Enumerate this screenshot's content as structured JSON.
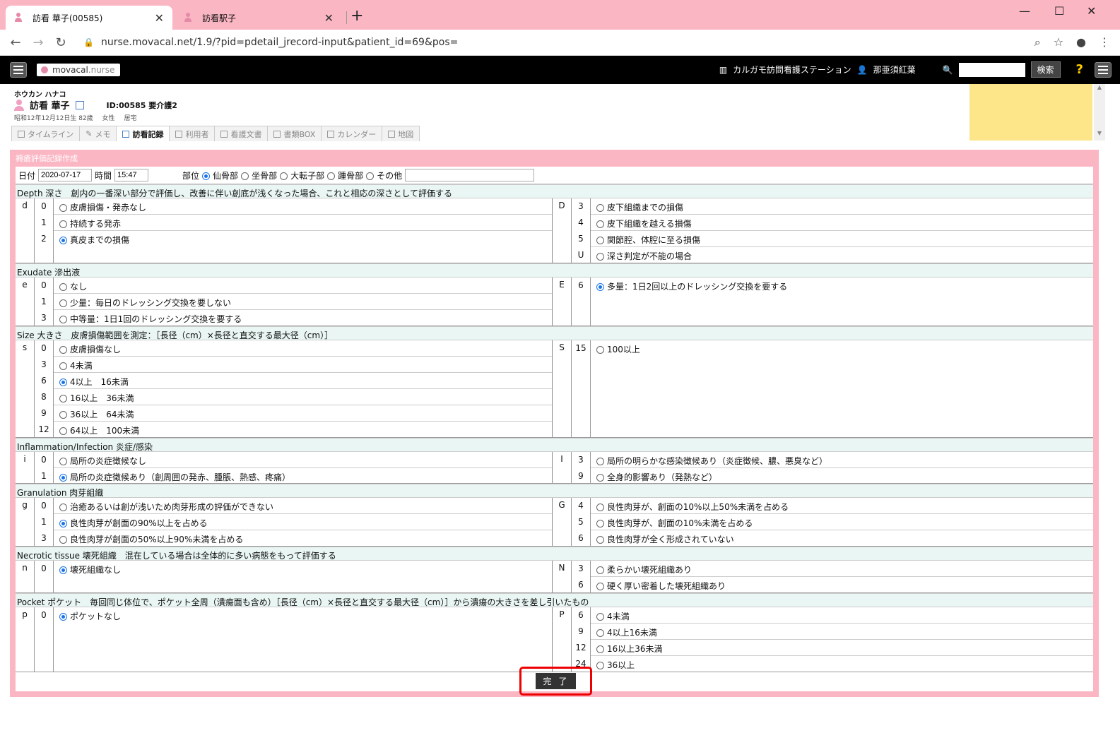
{
  "browser": {
    "tabs": [
      {
        "title": "訪看 華子(00585)"
      },
      {
        "title": "訪看駅子"
      }
    ],
    "new_tab": "+",
    "url": "nurse.movacal.net/1.9/?pid=pdetail_jrecord-input&patient_id=69&pos="
  },
  "app": {
    "logo_main": "movacal",
    "logo_sub": ".nurse",
    "station": "カルガモ訪問看護ステーション",
    "user": "那亜須紅葉",
    "search_button": "検索",
    "help": "?"
  },
  "patient": {
    "kana": "ホウカン ハナコ",
    "name": "訪看 華子",
    "id_care": "ID:00585 要介護2",
    "birth": "昭和12年12月12日生 82歳",
    "sex": "女性",
    "residence": "居宅",
    "tabs": [
      "タイムライン",
      "メモ",
      "訪看記録",
      "利用者",
      "看護文書",
      "書類BOX",
      "カレンダー",
      "地図"
    ]
  },
  "form": {
    "panel_title": "褥瘡評価記録作成",
    "date_label": "日付",
    "date_value": "2020-07-17",
    "time_label": "時間",
    "time_value": "15:47",
    "site_label": "部位",
    "sites": [
      "仙骨部",
      "坐骨部",
      "大転子部",
      "踵骨部",
      "その他"
    ],
    "sections": [
      {
        "header": "Depth 深さ　創内の一番深い部分で評価し、改善に伴い創底が浅くなった場合、これと相応の深さとして評価する",
        "left_code": "d",
        "left": [
          [
            "0",
            "皮膚損傷・発赤なし"
          ],
          [
            "1",
            "持続する発赤"
          ],
          [
            "2",
            "真皮までの損傷"
          ]
        ],
        "right_code": "D",
        "right": [
          [
            "3",
            "皮下組織までの損傷"
          ],
          [
            "4",
            "皮下組織を越える損傷"
          ],
          [
            "5",
            "関節腔、体腔に至る損傷"
          ],
          [
            "U",
            "深さ判定が不能の場合"
          ]
        ]
      },
      {
        "header": "Exudate 滲出液",
        "left_code": "e",
        "left": [
          [
            "0",
            "なし"
          ],
          [
            "1",
            "少量：毎日のドレッシング交換を要しない"
          ],
          [
            "3",
            "中等量：1日1回のドレッシング交換を要する"
          ]
        ],
        "right_code": "E",
        "right": [
          [
            "6",
            "多量：1日2回以上のドレッシング交換を要する"
          ]
        ]
      },
      {
        "header": "Size 大きさ　皮膚損傷範囲を測定：［長径（cm）×長径と直交する最大径（cm）］",
        "left_code": "s",
        "left": [
          [
            "0",
            "皮膚損傷なし"
          ],
          [
            "3",
            "4未満"
          ],
          [
            "6",
            "4以上　16未満"
          ],
          [
            "8",
            "16以上　36未満"
          ],
          [
            "9",
            "36以上　64未満"
          ],
          [
            "12",
            "64以上　100未満"
          ]
        ],
        "right_code": "S",
        "right": [
          [
            "15",
            "100以上"
          ]
        ]
      },
      {
        "header": "Inflammation/Infection 炎症/感染",
        "left_code": "i",
        "left": [
          [
            "0",
            "局所の炎症徴候なし"
          ],
          [
            "1",
            "局所の炎症徴候あり（創周囲の発赤、腫脹、熱感、疼痛）"
          ]
        ],
        "right_code": "I",
        "right": [
          [
            "3",
            "局所の明らかな感染徴候あり（炎症徴候、膿、悪臭など）"
          ],
          [
            "9",
            "全身的影響あり（発熱など）"
          ]
        ]
      },
      {
        "header": "Granulation 肉芽組織",
        "left_code": "g",
        "left": [
          [
            "0",
            "治癒あるいは創が浅いため肉芽形成の評価ができない"
          ],
          [
            "1",
            "良性肉芽が創面の90%以上を占める"
          ],
          [
            "3",
            "良性肉芽が創面の50%以上90%未満を占める"
          ]
        ],
        "right_code": "G",
        "right": [
          [
            "4",
            "良性肉芽が、創面の10%以上50%未満を占める"
          ],
          [
            "5",
            "良性肉芽が、創面の10%未満を占める"
          ],
          [
            "6",
            "良性肉芽が全く形成されていない"
          ]
        ]
      },
      {
        "header": "Necrotic tissue 壊死組織　混在している場合は全体的に多い病態をもって評価する",
        "left_code": "n",
        "left": [
          [
            "0",
            "壊死組織なし"
          ]
        ],
        "right_code": "N",
        "right": [
          [
            "3",
            "柔らかい壊死組織あり"
          ],
          [
            "6",
            "硬く厚い密着した壊死組織あり"
          ]
        ]
      },
      {
        "header": "Pocket ポケット　毎回同じ体位で、ポケット全周（潰瘍面も含め）［長径（cm）×長径と直交する最大径（cm）］から潰瘍の大きさを差し引いたもの",
        "left_code": "p",
        "left": [
          [
            "0",
            "ポケットなし"
          ]
        ],
        "right_code": "P",
        "right": [
          [
            "6",
            "4未満"
          ],
          [
            "9",
            "4以上16未満"
          ],
          [
            "12",
            "16以上36未満"
          ],
          [
            "24",
            "36以上"
          ]
        ]
      }
    ],
    "done_button": "完了"
  }
}
